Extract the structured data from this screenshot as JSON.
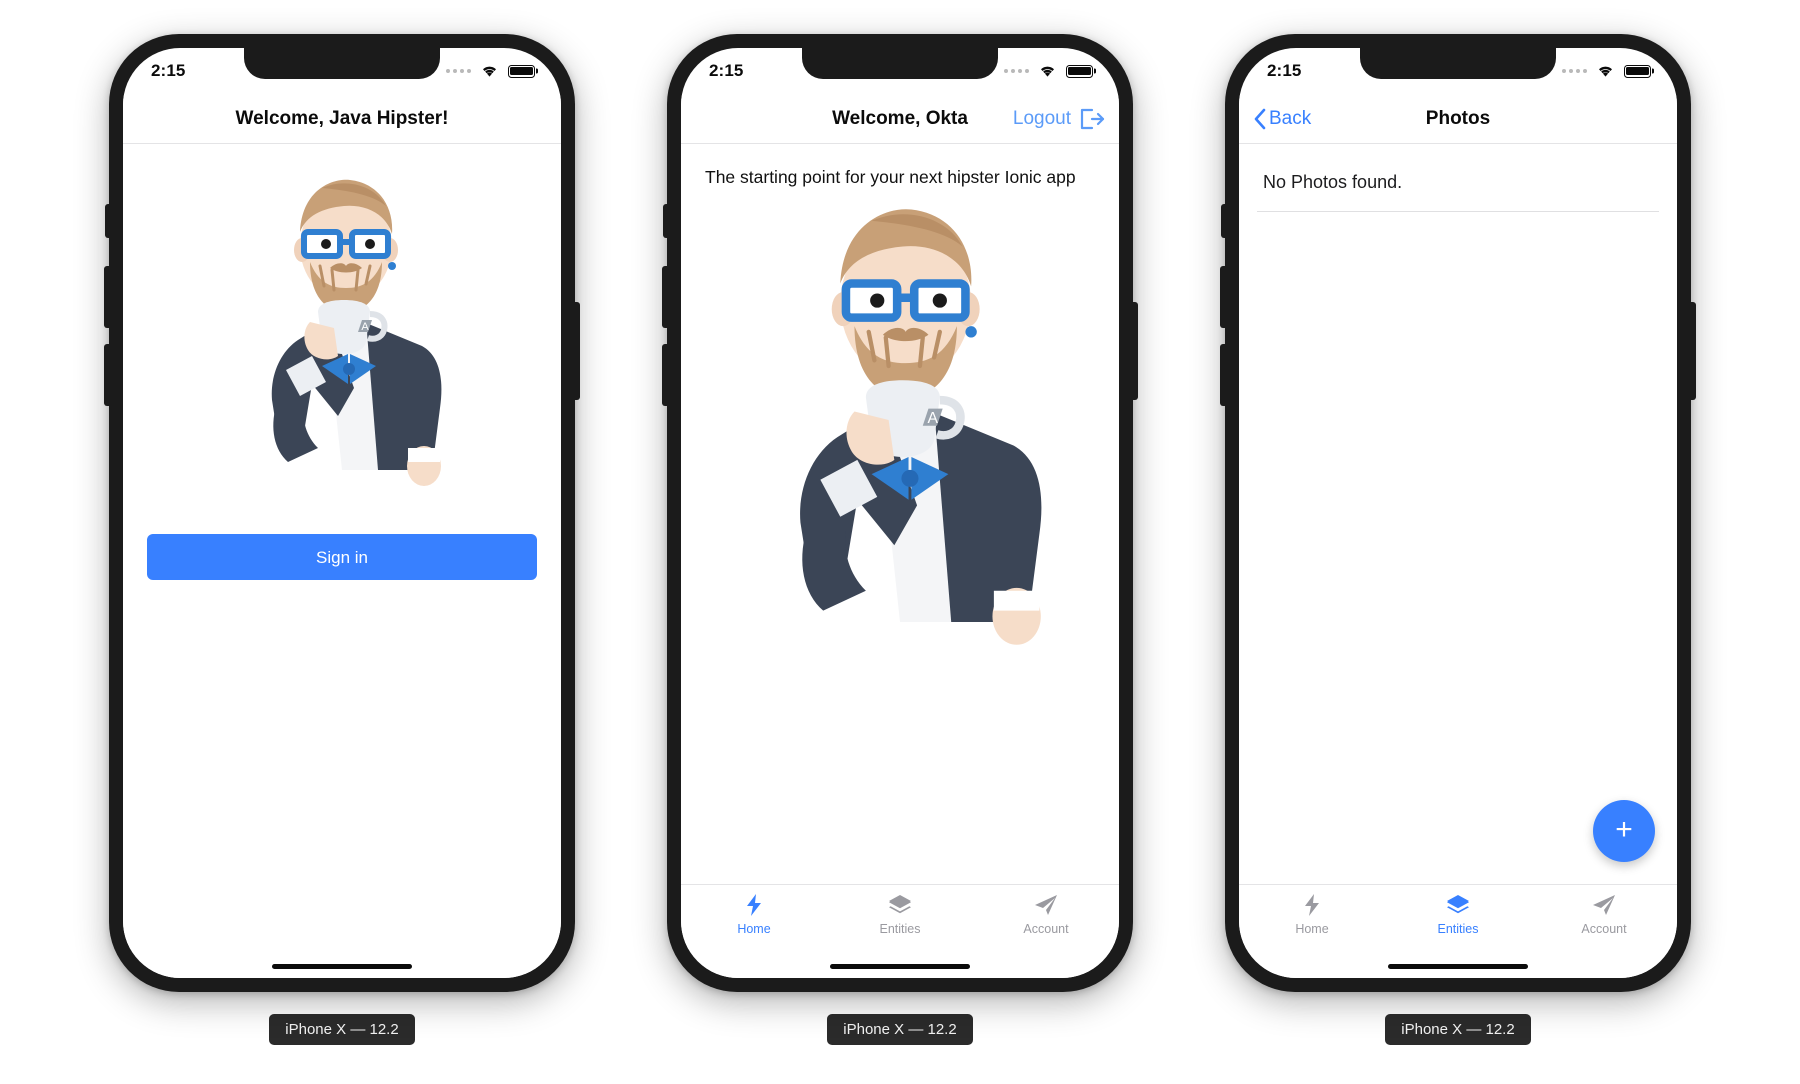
{
  "colors": {
    "accent": "#3880ff",
    "accent_light": "#5b9bf8",
    "inactive_tab": "#9a9aa0",
    "device_frame": "#1b1b1b",
    "screen_bg": "#ffffff",
    "separator": "#e4e4e6"
  },
  "status_bar": {
    "time": "2:15",
    "signal_icon": "signal-dots-icon",
    "wifi_icon": "wifi-icon",
    "battery_icon": "battery-icon"
  },
  "device_label": "iPhone X — 12.2",
  "phones": [
    {
      "id": "phone-login",
      "nav": {
        "title": "Welcome, Java Hipster!",
        "left_label": "",
        "right_label": ""
      },
      "lead_text": "",
      "mascot_alt": "jhipster-mascot",
      "signin_label": "Sign in",
      "empty_text": "",
      "has_tabbar": false,
      "has_fab": false
    },
    {
      "id": "phone-home",
      "nav": {
        "title": "Welcome, Okta",
        "left_label": "",
        "right_label": "Logout",
        "right_icon": "logout-icon"
      },
      "lead_text": "The starting point for your next hipster Ionic app",
      "mascot_alt": "jhipster-mascot",
      "signin_label": "",
      "empty_text": "",
      "has_tabbar": true,
      "has_fab": false,
      "active_tab": "Home"
    },
    {
      "id": "phone-photos",
      "nav": {
        "title": "Photos",
        "left_label": "Back",
        "left_icon": "chevron-left-icon",
        "right_label": ""
      },
      "lead_text": "",
      "mascot_alt": "",
      "signin_label": "",
      "empty_text": "No Photos found.",
      "has_tabbar": true,
      "has_fab": true,
      "fab_label": "+",
      "active_tab": "Entities"
    }
  ],
  "tabs": [
    {
      "label": "Home",
      "icon": "flash-icon"
    },
    {
      "label": "Entities",
      "icon": "layers-icon"
    },
    {
      "label": "Account",
      "icon": "paper-plane-icon"
    }
  ]
}
